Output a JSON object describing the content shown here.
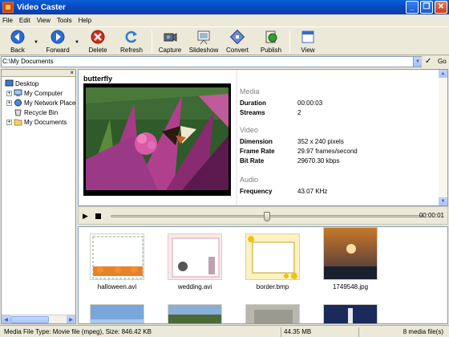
{
  "window": {
    "title": "Video Caster"
  },
  "menu": [
    "File",
    "Edit",
    "View",
    "Tools",
    "Help"
  ],
  "toolbar": {
    "back": "Back",
    "forward": "Forward",
    "delete": "Delete",
    "refresh": "Refresh",
    "capture": "Capture",
    "slideshow": "Slideshow",
    "convert": "Convert",
    "publish": "Publish",
    "view": "View"
  },
  "address": {
    "path": "C:\\My Documents",
    "go": "Go"
  },
  "tree": [
    "Desktop",
    "My Computer",
    "My Network Place",
    "Recycle Bin",
    "My Documents"
  ],
  "preview": {
    "title": "butterfly",
    "media_header": "Media",
    "video_header": "Video",
    "audio_header": "Audio",
    "duration_label": "Duration",
    "duration": "00:00:03",
    "streams_label": "Streams",
    "streams": "2",
    "dimension_label": "Dimension",
    "dimension": "352 x 240 pixels",
    "framerate_label": "Frame Rate",
    "framerate": "29.97 frames/second",
    "bitrate_label": "Bit Rate",
    "bitrate": "29670.30 kbps",
    "frequency_label": "Frequency",
    "frequency": "43.07 KHz"
  },
  "player": {
    "time": "00:00:01",
    "progress": 0.5
  },
  "thumbnails": [
    {
      "name": "halloween.avi"
    },
    {
      "name": "wedding.avi"
    },
    {
      "name": "border.bmp"
    },
    {
      "name": "1749548.jpg"
    }
  ],
  "status": {
    "type": "Media File Type: Movie file (mpeg), Size: 846.42 KB",
    "size": "44.35 MB",
    "count": "8 media file(s)"
  }
}
